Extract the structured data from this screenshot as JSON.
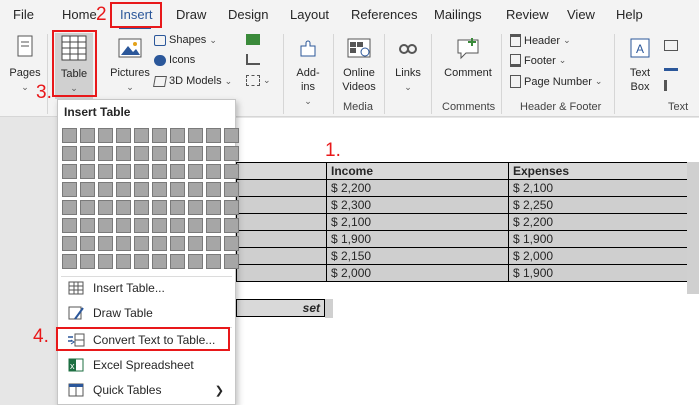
{
  "tabs": [
    "File",
    "Home",
    "Insert",
    "Draw",
    "Design",
    "Layout",
    "References",
    "Mailings",
    "Review",
    "View",
    "Help"
  ],
  "ribbon": {
    "pages": "Pages",
    "table": "Table",
    "pictures": "Pictures",
    "shapes": "Shapes",
    "icons": "Icons",
    "models": "3D Models",
    "addins": "Add-ins",
    "online_videos": "Online Videos",
    "links": "Links",
    "comment": "Comment",
    "header": "Header",
    "footer": "Footer",
    "page_number": "Page Number",
    "text_box": "Text Box",
    "groups": {
      "media": "Media",
      "comments": "Comments",
      "header_footer": "Header & Footer",
      "text": "Text"
    }
  },
  "menu": {
    "title": "Insert Table",
    "items": [
      {
        "label": "Insert Table...",
        "icon": "insert-table-icon"
      },
      {
        "label": "Draw Table",
        "icon": "draw-table-icon"
      },
      {
        "label": "Convert Text to Table...",
        "icon": "convert-text-icon"
      },
      {
        "label": "Excel Spreadsheet",
        "icon": "excel-icon"
      },
      {
        "label": "Quick Tables",
        "icon": "quick-tables-icon"
      }
    ]
  },
  "document": {
    "table": {
      "headers": [
        "Income",
        "Expenses"
      ],
      "rows": [
        [
          "$ 2,200",
          "$ 2,100"
        ],
        [
          "$ 2,300",
          "$ 2,250"
        ],
        [
          "$ 2,100",
          "$ 2,200"
        ],
        [
          "$ 1,900",
          "$ 1,900"
        ],
        [
          "$ 2,150",
          "$ 2,000"
        ],
        [
          "$ 2,000",
          "$ 1,900"
        ]
      ]
    },
    "partial_label": "set"
  },
  "annotations": {
    "a1": "1.",
    "a2": "2",
    "a3": "3.",
    "a4": "4."
  },
  "colors": {
    "accent": "#2b579a",
    "annotation_red": "#e8181a"
  }
}
